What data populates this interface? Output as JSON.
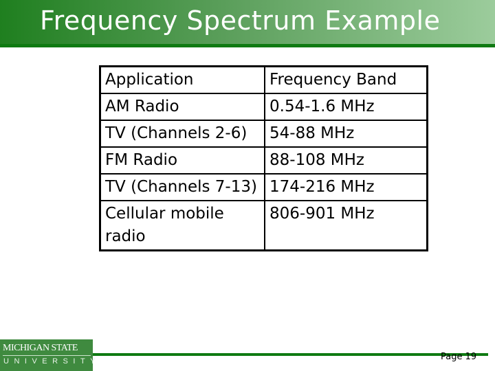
{
  "slide": {
    "title": "Frequency Spectrum Example",
    "page_label": "Page 19"
  },
  "logo": {
    "line1": "MICHIGAN STATE",
    "line2": "UNIVERSITY"
  },
  "table": {
    "headers": [
      "Application",
      "Frequency Band"
    ],
    "rows": [
      [
        "AM Radio",
        "0.54-1.6 MHz"
      ],
      [
        "TV (Channels 2-6)",
        "54-88 MHz"
      ],
      [
        "FM Radio",
        "88-108 MHz"
      ],
      [
        "TV (Channels 7-13)",
        "174-216 MHz"
      ],
      [
        "Cellular mobile radio",
        "806-901 MHz"
      ]
    ]
  },
  "colors": {
    "brand_green": "#0f7a12",
    "logo_green": "#3f8a3f"
  }
}
